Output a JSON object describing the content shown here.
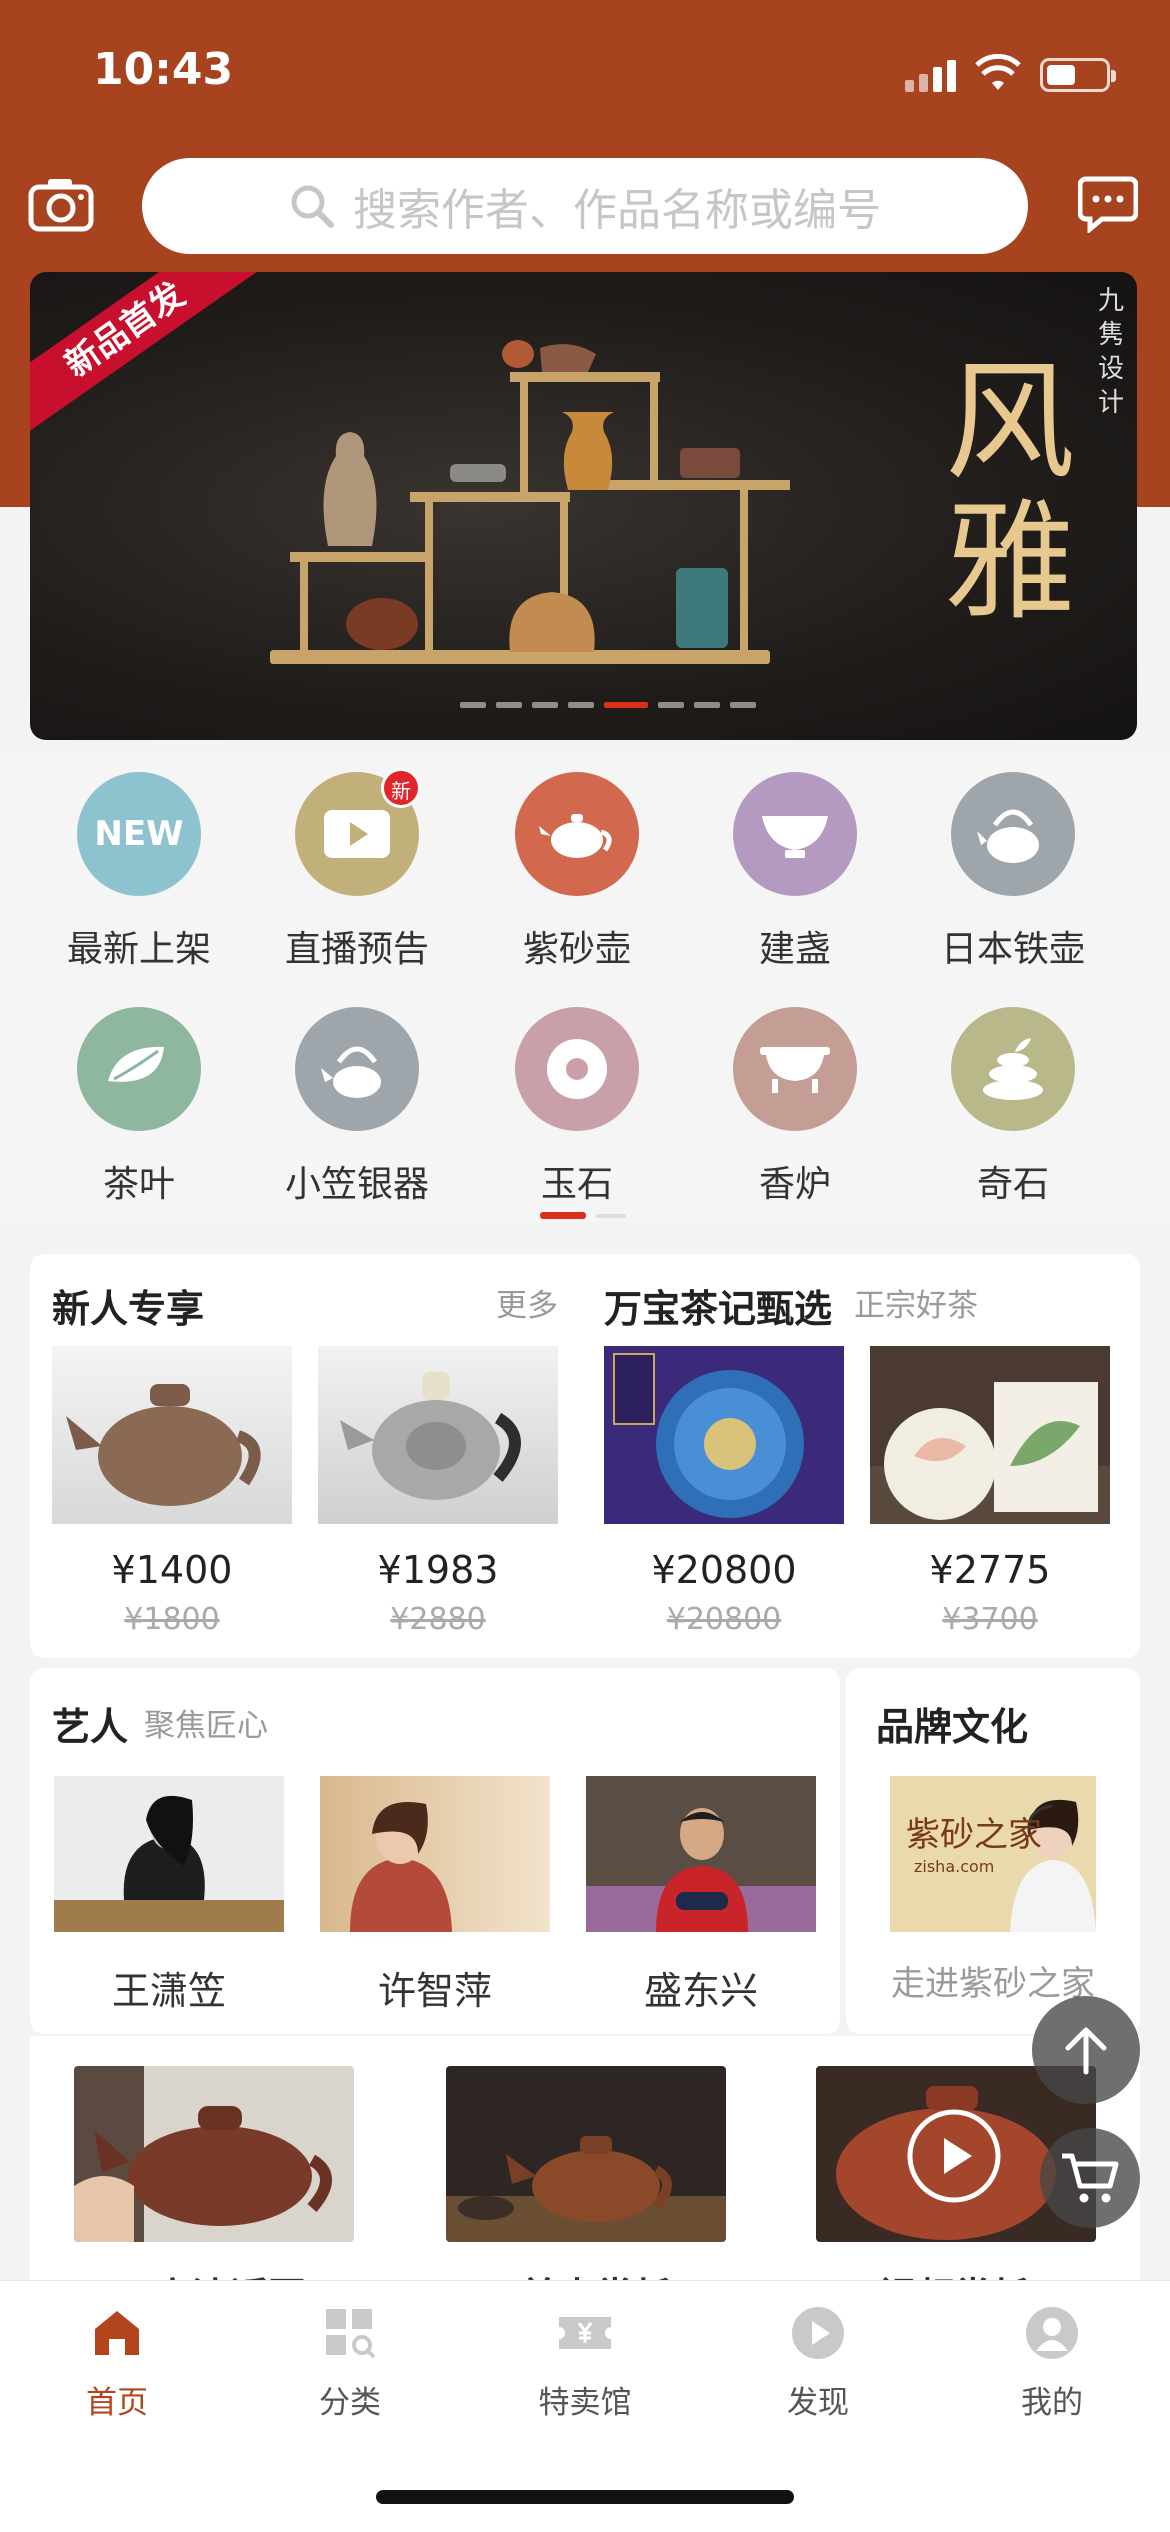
{
  "status_bar": {
    "time": "10:43"
  },
  "search": {
    "placeholder": "搜索作者、作品名称或编号"
  },
  "banner": {
    "ribbon": "新品首发",
    "calligraphy": "风雅",
    "brand": "九隽设计",
    "slides": 8,
    "active_slide": 5
  },
  "categories": [
    {
      "label": "最新上架",
      "icon": "new-icon",
      "color": "#8cc3cf"
    },
    {
      "label": "直播预告",
      "icon": "live-video-icon",
      "color": "#c1b07a",
      "badge": "新"
    },
    {
      "label": "紫砂壶",
      "icon": "teapot-icon",
      "color": "#d2694e"
    },
    {
      "label": "建盏",
      "icon": "tea-bowl-icon",
      "color": "#b49ac0"
    },
    {
      "label": "日本铁壶",
      "icon": "iron-kettle-icon",
      "color": "#9ea6ab"
    },
    {
      "label": "茶叶",
      "icon": "tea-leaf-icon",
      "color": "#8fb79f"
    },
    {
      "label": "小笠银器",
      "icon": "silver-kettle-icon",
      "color": "#9ea6ab"
    },
    {
      "label": "玉石",
      "icon": "jade-disc-icon",
      "color": "#c9a0a8"
    },
    {
      "label": "香炉",
      "icon": "censer-icon",
      "color": "#c49e95"
    },
    {
      "label": "奇石",
      "icon": "stones-icon",
      "color": "#b8b88a"
    }
  ],
  "promo": {
    "newcomer": {
      "title": "新人专享",
      "more": "更多",
      "items": [
        {
          "price": "¥1400",
          "orig": "¥1800",
          "image": "clay-teapot"
        },
        {
          "price": "¥1983",
          "orig": "¥2880",
          "image": "silver-teapot"
        }
      ]
    },
    "tea": {
      "title": "万宝茶记甄选",
      "subtitle": "正宗好茶",
      "items": [
        {
          "price": "¥20800",
          "orig": "¥20800",
          "image": "tea-cake-box"
        },
        {
          "price": "¥2775",
          "orig": "¥3700",
          "image": "tea-gift-box"
        }
      ]
    }
  },
  "artists": {
    "title": "艺人",
    "subtitle": "聚焦匠心",
    "items": [
      {
        "name": "王潇笠"
      },
      {
        "name": "许智萍"
      },
      {
        "name": "盛东兴"
      }
    ]
  },
  "brand_culture": {
    "title": "品牌文化",
    "caption": "走进紫砂之家",
    "image_text": "紫砂之家",
    "image_domain": "zisha.com"
  },
  "video_row": [
    {
      "label": "高清近图"
    },
    {
      "label": "美壶赏析"
    },
    {
      "label": "视频赏析"
    }
  ],
  "tabs": [
    {
      "label": "首页",
      "icon": "home-icon",
      "active": true
    },
    {
      "label": "分类",
      "icon": "category-icon",
      "active": false
    },
    {
      "label": "特卖馆",
      "icon": "ticket-icon",
      "active": false
    },
    {
      "label": "发现",
      "icon": "play-icon",
      "active": false
    },
    {
      "label": "我的",
      "icon": "user-icon",
      "active": false
    }
  ],
  "colors": {
    "header": "#a8431f",
    "accent": "#d9301c",
    "active_tab": "#b3451d"
  }
}
